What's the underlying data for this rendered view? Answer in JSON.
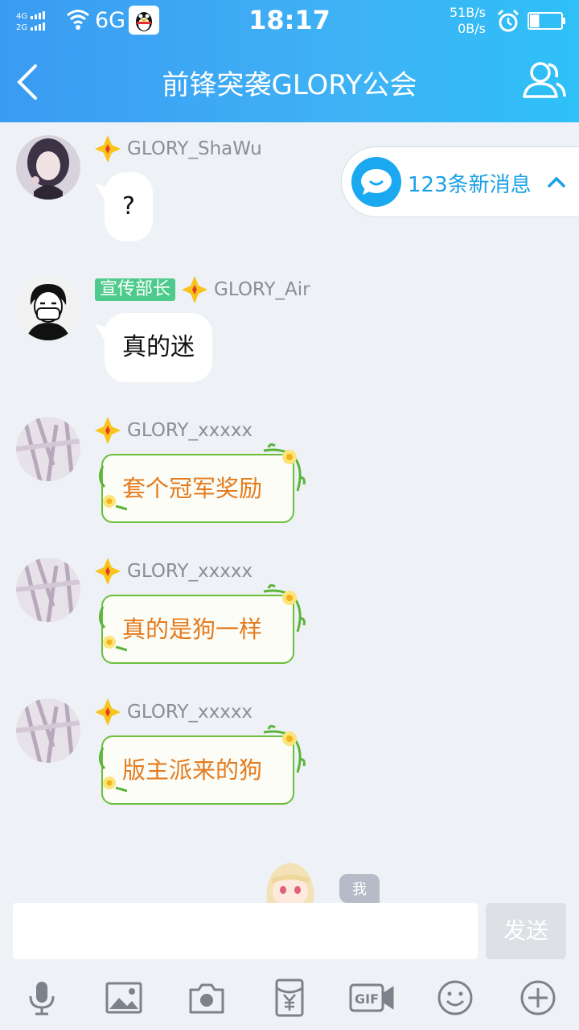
{
  "status_bar": {
    "network": "6G",
    "time": "18:17",
    "speed_up": "51B/s",
    "speed_down": "0B/s",
    "battery_level": 0.3
  },
  "header": {
    "title": "前锋突袭GLORY公会"
  },
  "messages": [
    {
      "nick": "GLORY_ShaWu",
      "text": "?",
      "style": "plain"
    },
    {
      "role": "宣传部长",
      "nick": "GLORY_Air",
      "text": "真的迷",
      "style": "plain"
    },
    {
      "nick": "GLORY_xxxxx",
      "text": "套个冠军奖励",
      "style": "flower"
    },
    {
      "nick": "GLORY_xxxxx",
      "text": "真的是狗一样",
      "style": "flower"
    },
    {
      "nick": "GLORY_xxxxx",
      "text": "版主派来的狗",
      "style": "flower"
    }
  ],
  "new_messages": {
    "label": "123条新消息"
  },
  "me_tag": "我",
  "input": {
    "value": "",
    "send_label": "发送"
  },
  "toolbar": [
    "microphone-icon",
    "image-icon",
    "camera-icon",
    "red-packet-icon",
    "gif-icon",
    "emoji-icon",
    "plus-icon"
  ],
  "colors": {
    "header_blue": "#3a9bf2",
    "accent_blue": "#1aa0e6",
    "role_green": "#4ecb8c",
    "flower_orange": "#e57b1f",
    "bg": "#eef1f6"
  }
}
